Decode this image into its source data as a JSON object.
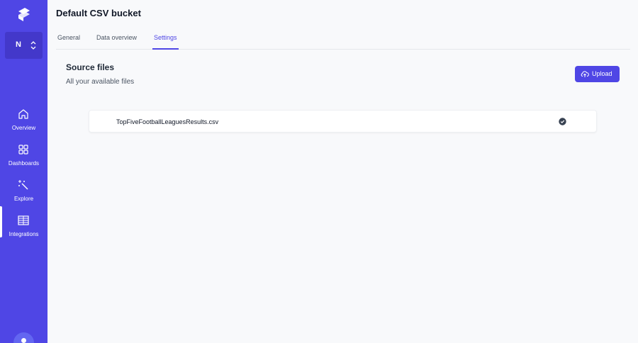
{
  "app": {
    "logo_icon": "logo-icon",
    "accent": "#4f46e5"
  },
  "workspace": {
    "initial": "N",
    "switch_icon": "chevron-up-down-icon"
  },
  "nav": [
    {
      "label": "Overview",
      "icon": "home-icon",
      "active": false
    },
    {
      "label": "Dashboards",
      "icon": "grid-icon",
      "active": false
    },
    {
      "label": "Explore",
      "icon": "magic-wand-icon",
      "active": false
    },
    {
      "label": "Integrations",
      "icon": "table-icon",
      "active": true
    }
  ],
  "header": {
    "title": "Default CSV bucket"
  },
  "tabs": [
    {
      "label": "General",
      "active": false
    },
    {
      "label": "Data overview",
      "active": false
    },
    {
      "label": "Settings",
      "active": true
    }
  ],
  "source_files": {
    "title": "Source files",
    "subtitle": "All your available files",
    "upload_label": "Upload",
    "files": [
      {
        "name": "TopFiveFootballLeaguesResults.csv",
        "status_icon": "check-circle-icon"
      }
    ]
  }
}
